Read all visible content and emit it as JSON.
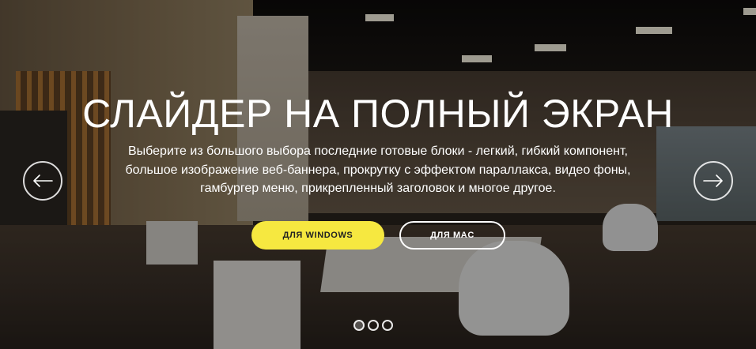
{
  "hero": {
    "title": "СЛАЙДЕР НА ПОЛНЫЙ ЭКРАН",
    "subtitle_lines": [
      "Выберите из большого выбора последние готовые блоки - легкий, гибкий компонент,",
      "большое изображение веб-баннера, прокрутку с эффектом параллакса, видео фоны,",
      "гамбургер меню, прикрепленный заголовок и многое другое."
    ]
  },
  "buttons": {
    "windows_label": "ДЛЯ WINDOWS",
    "mac_label": "ДЛЯ MAC"
  },
  "navigation": {
    "prev_icon": "arrow-left-icon",
    "next_icon": "arrow-right-icon"
  },
  "pagination": {
    "total": 3,
    "active_index": 0
  },
  "colors": {
    "accent": "#f6e840",
    "text": "#ffffff"
  },
  "background": {
    "description_icon": "office-photo"
  }
}
